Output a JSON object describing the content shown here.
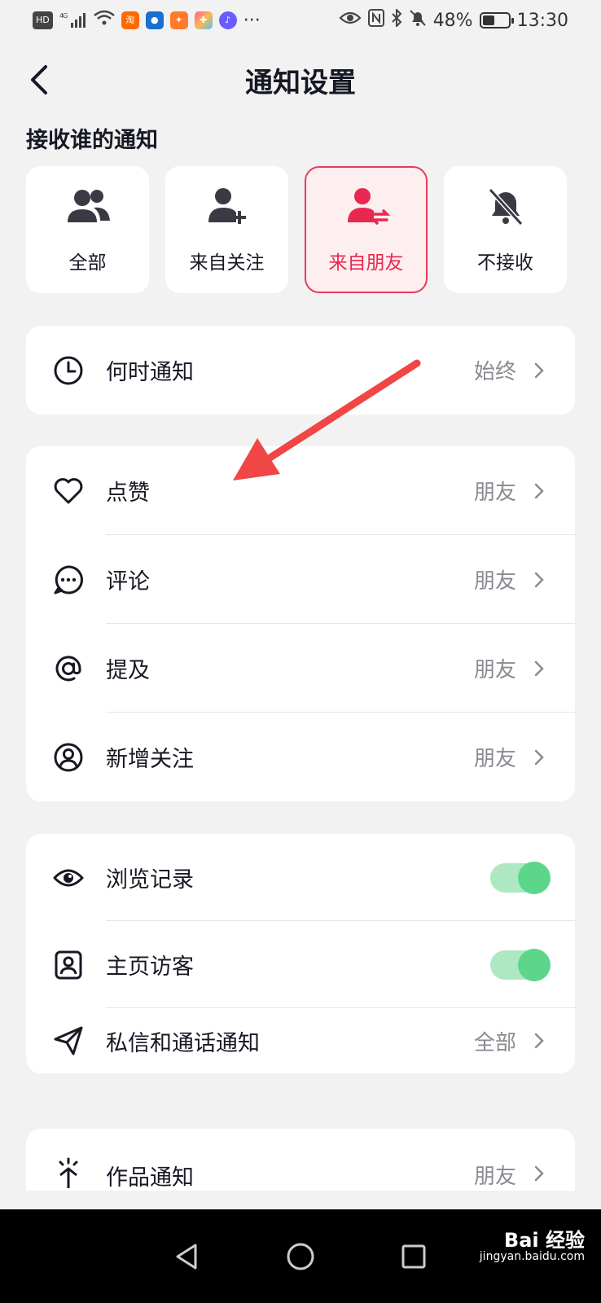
{
  "status_bar": {
    "hd": "HD",
    "signal": "4G",
    "more": "···",
    "battery": "48%",
    "battery_level": 0.48,
    "time": "13:30",
    "app_icons": [
      "taobao-icon",
      "bird-app-icon",
      "orange-app-icon",
      "colorful-app-icon",
      "music-icon"
    ]
  },
  "nav": {
    "title": "通知设置"
  },
  "who": {
    "section_title": "接收谁的通知",
    "options": [
      {
        "label": "全部",
        "icon": "people-icon",
        "selected": false
      },
      {
        "label": "来自关注",
        "icon": "person-add-icon",
        "selected": false
      },
      {
        "label": "来自朋友",
        "icon": "person-exchange-icon",
        "selected": true
      },
      {
        "label": "不接收",
        "icon": "bell-off-icon",
        "selected": false
      }
    ]
  },
  "when": {
    "label": "何时通知",
    "value": "始终",
    "icon": "clock-icon"
  },
  "interactions": [
    {
      "label": "点赞",
      "value": "朋友",
      "icon": "heart-icon"
    },
    {
      "label": "评论",
      "value": "朋友",
      "icon": "comment-icon"
    },
    {
      "label": "提及",
      "value": "朋友",
      "icon": "at-icon"
    },
    {
      "label": "新增关注",
      "value": "朋友",
      "icon": "user-circle-icon"
    }
  ],
  "privacy": {
    "browse": {
      "label": "浏览记录",
      "enabled": true,
      "icon": "eye-icon"
    },
    "visitors": {
      "label": "主页访客",
      "enabled": true,
      "icon": "profile-card-icon"
    },
    "messages": {
      "label": "私信和通话通知",
      "value": "全部",
      "icon": "send-icon"
    }
  },
  "works": {
    "label": "作品通知",
    "value": "朋友",
    "icon": "sparkle-icon"
  },
  "watermark": {
    "brand": "Bai 经验",
    "url": "jingyan.baidu.com"
  },
  "colors": {
    "accent": "#e8284f",
    "toggle_on": "#5cd68a",
    "annotation_arrow": "#f04646"
  }
}
